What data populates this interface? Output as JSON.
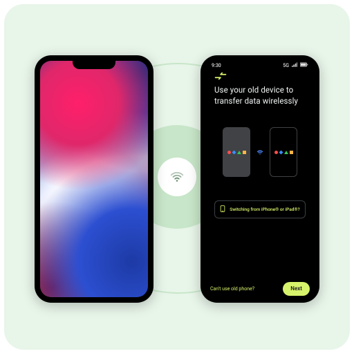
{
  "status": {
    "time": "9:30",
    "network": "5G"
  },
  "transfer": {
    "heading_line1": "Use your old device to",
    "heading_line2": "transfer data wirelessly",
    "switching_text": "Switching from iPhone® or iPad®?"
  },
  "footer": {
    "cant_use_link": "Can't use old phone?",
    "next_label": "Next"
  },
  "icons": {
    "wifi": "wifi-icon",
    "signal": "signal-icon",
    "battery": "battery-icon",
    "swap": "swap-icon",
    "phone_small": "phone-icon"
  }
}
